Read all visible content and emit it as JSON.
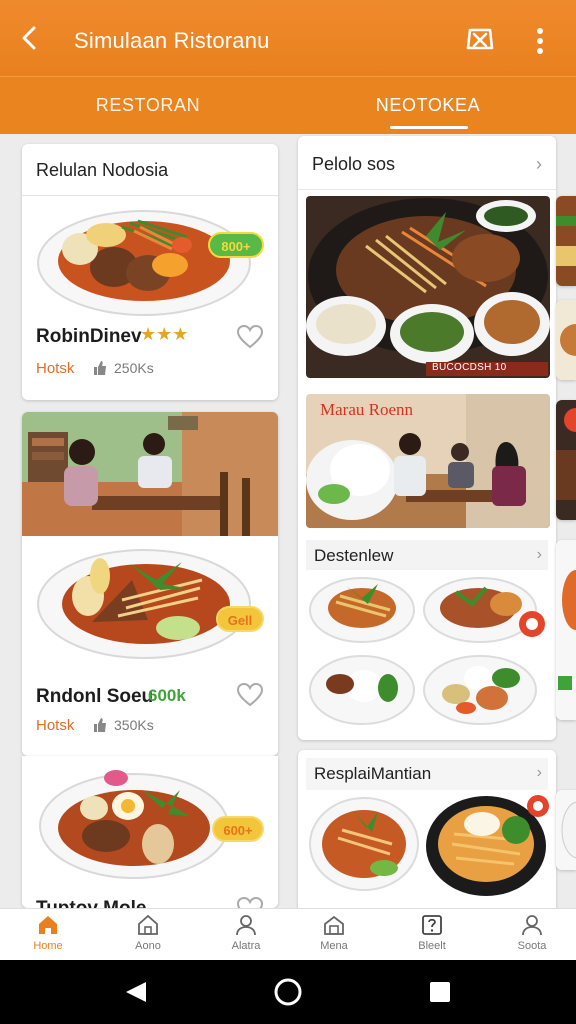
{
  "header": {
    "title": "Simulaan Ristoranu",
    "back_icon": "back-arrow-icon",
    "action_icon": "map-pin-off-icon",
    "more_icon": "more-vertical-icon"
  },
  "tabs": [
    {
      "label": "RESTORAN",
      "active": false
    },
    {
      "label": "NEOTOKEA",
      "active": true
    }
  ],
  "left_column": {
    "card1": {
      "header": "Relulan Nodosia",
      "name": "RobinDinev",
      "stars": "★★★",
      "tag": "Hotsk",
      "count": "250Ks",
      "badge": "800+"
    },
    "card2": {
      "photo_caption": "",
      "name": "Rndonl Soeu",
      "name_accent": "600k",
      "tag": "Hotsk",
      "count": "350Ks",
      "badge": "Gell"
    },
    "card3": {
      "name": "Tuptov Mole",
      "badge": "600+"
    }
  },
  "right_column": {
    "section1": {
      "header": "Pelolo sos",
      "photo_overlay": "BUCOCDSH 10",
      "restaurant_sign": "Marau Roenn",
      "subsection": "Destenlew"
    },
    "section2": {
      "header": "ResplaiMantian"
    }
  },
  "bottom_nav": [
    {
      "label": "Home",
      "icon": "home-icon",
      "active": true
    },
    {
      "label": "Aono",
      "icon": "home-outline-icon",
      "active": false
    },
    {
      "label": "Alatra",
      "icon": "user-icon",
      "active": false
    },
    {
      "label": "Mena",
      "icon": "store-icon",
      "active": false
    },
    {
      "label": "Bleelt",
      "icon": "help-icon",
      "active": false
    },
    {
      "label": "Soota",
      "icon": "profile-icon",
      "active": false
    }
  ],
  "colors": {
    "primary": "#e9801f",
    "accent_green": "#3fa33a",
    "badge_yellow": "#f3c233",
    "background": "#ececec"
  }
}
